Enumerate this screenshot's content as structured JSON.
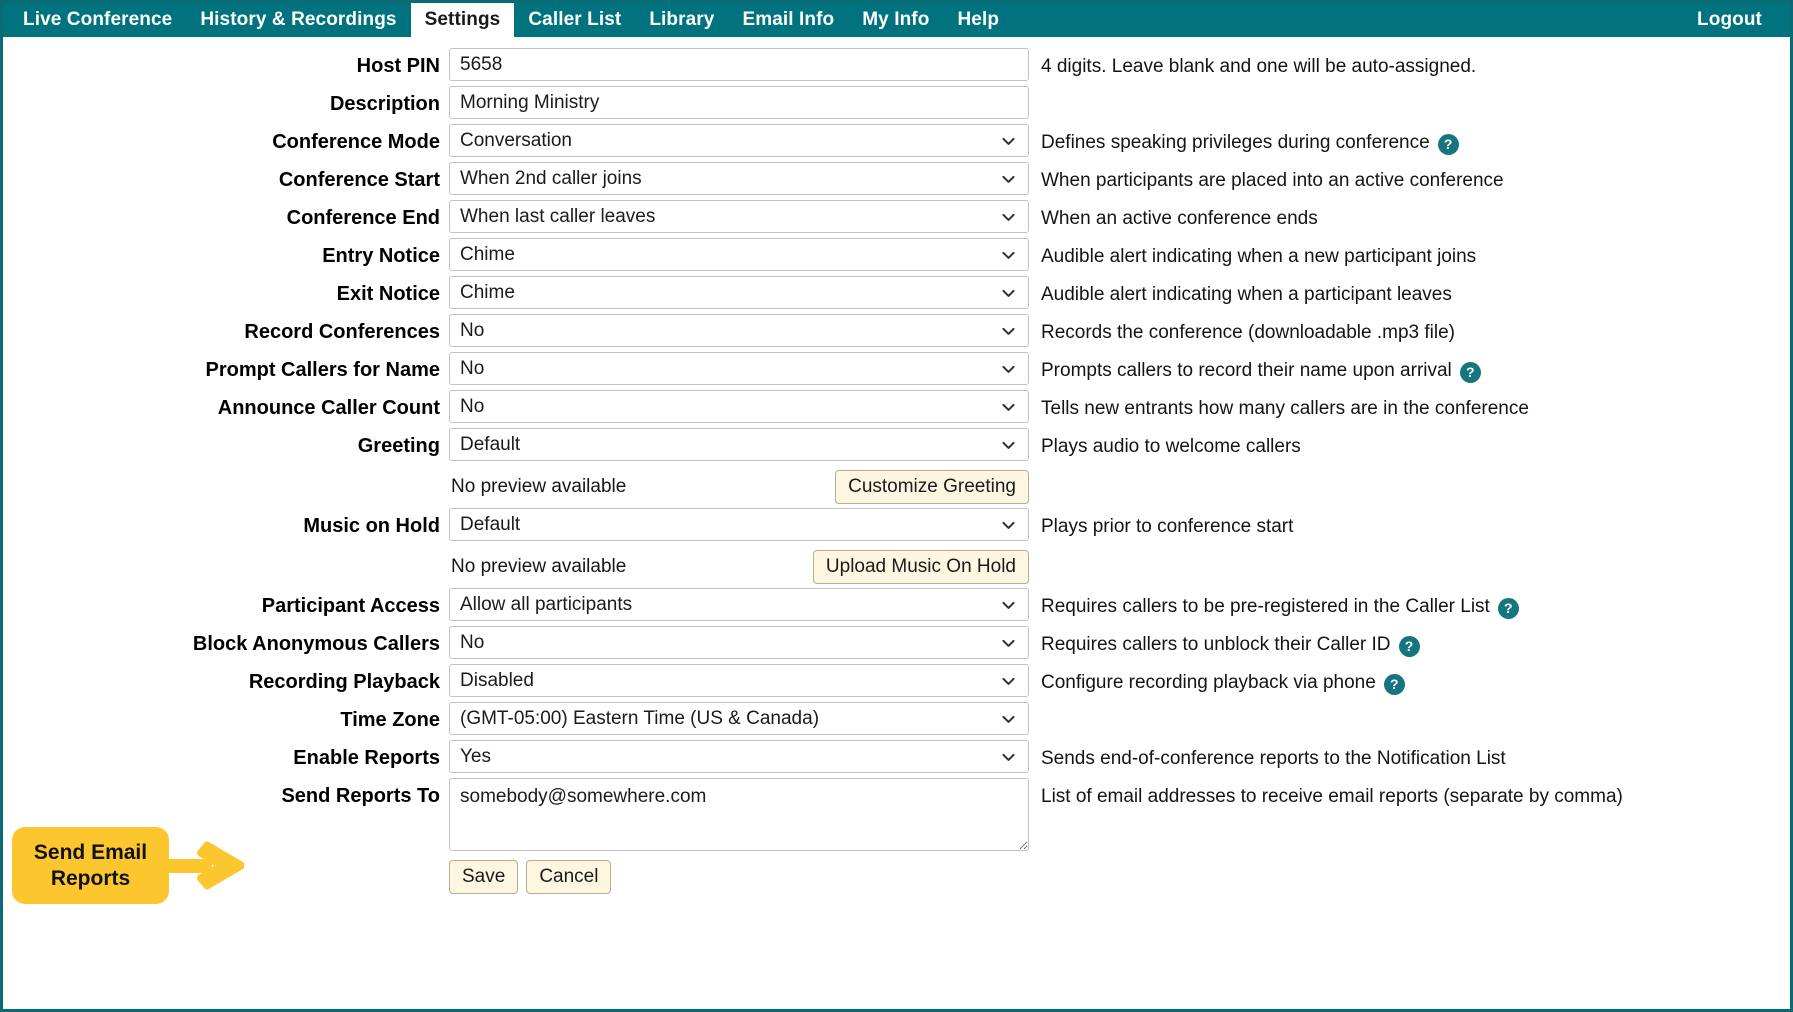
{
  "nav": {
    "items": [
      {
        "label": "Live Conference",
        "active": false
      },
      {
        "label": "History & Recordings",
        "active": false
      },
      {
        "label": "Settings",
        "active": true
      },
      {
        "label": "Caller List",
        "active": false
      },
      {
        "label": "Library",
        "active": false
      },
      {
        "label": "Email Info",
        "active": false
      },
      {
        "label": "My Info",
        "active": false
      },
      {
        "label": "Help",
        "active": false
      }
    ],
    "logout_label": "Logout"
  },
  "colors": {
    "navbar_teal": "#00737f",
    "page_border_teal": "#0b6b75",
    "callout_yellow": "#fcc72e",
    "help_badge_teal": "#16757f",
    "button_cream": "#fdf6e0"
  },
  "form": {
    "host_pin": {
      "label": "Host PIN",
      "value": "5658",
      "hint": "4 digits. Leave blank and one will be auto-assigned.",
      "has_help": false
    },
    "description": {
      "label": "Description",
      "value": "Morning Ministry",
      "hint": "",
      "has_help": false
    },
    "conference_mode": {
      "label": "Conference Mode",
      "value": "Conversation",
      "hint": "Defines speaking privileges during conference",
      "has_help": true
    },
    "conference_start": {
      "label": "Conference Start",
      "value": "When 2nd caller joins",
      "hint": "When participants are placed into an active conference",
      "has_help": false
    },
    "conference_end": {
      "label": "Conference End",
      "value": "When last caller leaves",
      "hint": "When an active conference ends",
      "has_help": false
    },
    "entry_notice": {
      "label": "Entry Notice",
      "value": "Chime",
      "hint": "Audible alert indicating when a new participant joins",
      "has_help": false
    },
    "exit_notice": {
      "label": "Exit Notice",
      "value": "Chime",
      "hint": "Audible alert indicating when a participant leaves",
      "has_help": false
    },
    "record_conferences": {
      "label": "Record Conferences",
      "value": "No",
      "hint": "Records the conference (downloadable .mp3 file)",
      "has_help": false
    },
    "prompt_callers_for_name": {
      "label": "Prompt Callers for Name",
      "value": "No",
      "hint": "Prompts callers to record their name upon arrival",
      "has_help": true
    },
    "announce_caller_count": {
      "label": "Announce Caller Count",
      "value": "No",
      "hint": "Tells new entrants how many callers are in the conference",
      "has_help": false
    },
    "greeting": {
      "label": "Greeting",
      "value": "Default",
      "hint": "Plays audio to welcome callers",
      "has_help": false,
      "preview_text": "No preview available",
      "button_label": "Customize Greeting"
    },
    "music_on_hold": {
      "label": "Music on Hold",
      "value": "Default",
      "hint": "Plays prior to conference start",
      "has_help": false,
      "preview_text": "No preview available",
      "button_label": "Upload Music On Hold"
    },
    "participant_access": {
      "label": "Participant Access",
      "value": "Allow all participants",
      "hint": "Requires callers to be pre-registered in the Caller List",
      "has_help": true
    },
    "block_anonymous_callers": {
      "label": "Block Anonymous Callers",
      "value": "No",
      "hint": "Requires callers to unblock their Caller ID",
      "has_help": true
    },
    "recording_playback": {
      "label": "Recording Playback",
      "value": "Disabled",
      "hint": "Configure recording playback via phone",
      "has_help": true
    },
    "time_zone": {
      "label": "Time Zone",
      "value": "(GMT-05:00) Eastern Time (US & Canada)",
      "hint": "",
      "has_help": false
    },
    "enable_reports": {
      "label": "Enable Reports",
      "value": "Yes",
      "hint": "Sends end-of-conference reports to the Notification List",
      "has_help": false
    },
    "send_reports_to": {
      "label": "Send Reports To",
      "value": "somebody@somewhere.com",
      "hint": "List of email addresses to receive email reports (separate by comma)",
      "has_help": false
    },
    "actions": {
      "save_label": "Save",
      "cancel_label": "Cancel"
    }
  },
  "annotation": {
    "callout_text": "Send Email Reports"
  },
  "help_badge_glyph": "?"
}
